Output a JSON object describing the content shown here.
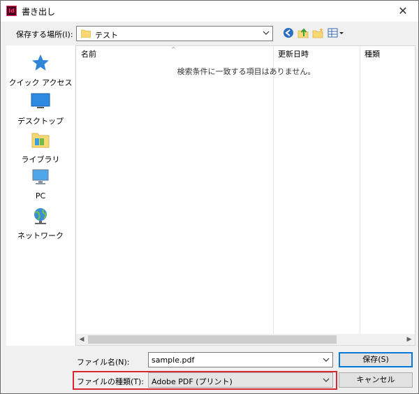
{
  "window": {
    "title": "書き出し",
    "app_icon_text": "Id",
    "close_glyph": "✕"
  },
  "location": {
    "label": "保存する場所(I):",
    "value": "テスト"
  },
  "places": [
    {
      "label": "クイック アクセス",
      "icon": "quick-access-star-icon"
    },
    {
      "label": "デスクトップ",
      "icon": "desktop-icon"
    },
    {
      "label": "ライブラリ",
      "icon": "library-icon"
    },
    {
      "label": "PC",
      "icon": "pc-icon"
    },
    {
      "label": "ネットワーク",
      "icon": "network-icon"
    }
  ],
  "list": {
    "columns": [
      "名前",
      "更新日時",
      "種類"
    ],
    "sort_glyph": "^",
    "empty_message": "検索条件に一致する項目はありません。"
  },
  "filename": {
    "label": "ファイル名(N):",
    "value": "sample.pdf"
  },
  "filetype": {
    "label": "ファイルの種類(T):",
    "value": "Adobe PDF (プリント)"
  },
  "buttons": {
    "save": "保存(S)",
    "cancel": "キャンセル"
  },
  "colors": {
    "accent": "#0078d7",
    "highlight": "#d7282f",
    "folder": "#f8d775"
  }
}
